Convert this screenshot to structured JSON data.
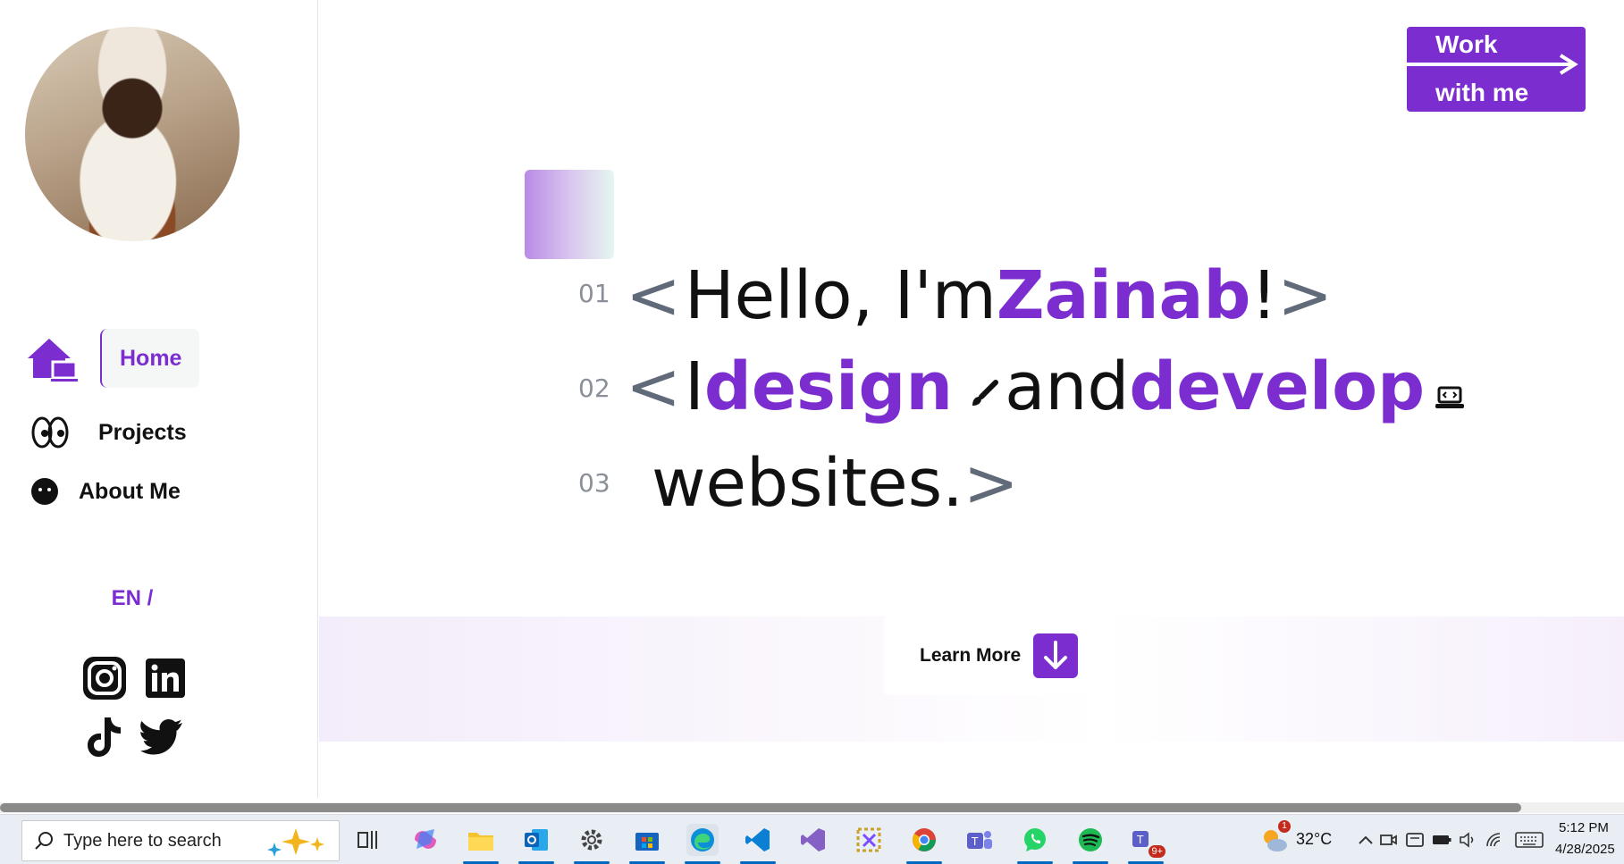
{
  "sidebar": {
    "nav": [
      {
        "label": "Home",
        "icon": "home-icon",
        "active": true
      },
      {
        "label": "Projects",
        "icon": "eyes-icon"
      },
      {
        "label": "About Me",
        "icon": "face-icon"
      }
    ],
    "language": "EN /",
    "socials": [
      "instagram-icon",
      "linkedin-icon",
      "tiktok-icon",
      "twitter-icon"
    ]
  },
  "header": {
    "work_line1": "Work",
    "work_line2": "with me"
  },
  "hero": {
    "line1": {
      "num": "01",
      "open": "<",
      "text": "Hello, I'm ",
      "name": "Zainab",
      "tail": "!",
      "close": ">"
    },
    "line2": {
      "num": "02",
      "open": "<",
      "text1": "I ",
      "word1": "design",
      "text2": " and ",
      "word2": "develop"
    },
    "line3": {
      "num": "03",
      "text": "websites.",
      "close": ">"
    }
  },
  "learn": {
    "label": "Learn More"
  },
  "taskbar": {
    "search_placeholder": "Type here to search",
    "weather": "32°C",
    "weather_badge": "1",
    "teams_badge": "9+",
    "time": "5:12 PM",
    "date": "4/28/2025"
  },
  "colors": {
    "accent": "#7b2dd0",
    "bracket": "#606a78"
  }
}
